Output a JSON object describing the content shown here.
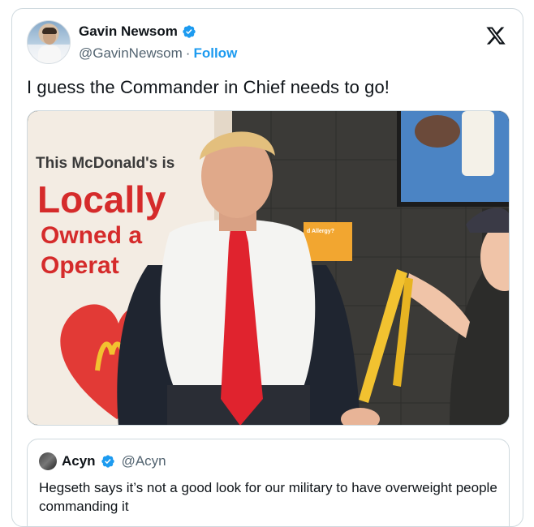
{
  "author": {
    "display_name": "Gavin Newsom",
    "handle": "@GavinNewsom",
    "separator": "·",
    "follow_label": "Follow",
    "verified": true
  },
  "tweet": {
    "text": "I guess the Commander in Chief needs to go!"
  },
  "media": {
    "sign_line1": "This McDonald's is",
    "sign_line2": "Locally",
    "sign_line3": "Owned a",
    "sign_line4": "Operat",
    "notice_text": "d Allergy?"
  },
  "quoted_tweet": {
    "display_name": "Acyn",
    "handle": "@Acyn",
    "verified": true,
    "text": "Hegseth says it’s not a good look for our military to have overweight people commanding it"
  },
  "colors": {
    "accent": "#1d9bf0",
    "sign_red": "#d52b2b",
    "tie_red": "#e0232e",
    "tape_yellow": "#f2c230"
  },
  "icons": {
    "logo": "x-logo-icon",
    "verified": "verified-badge-icon"
  }
}
